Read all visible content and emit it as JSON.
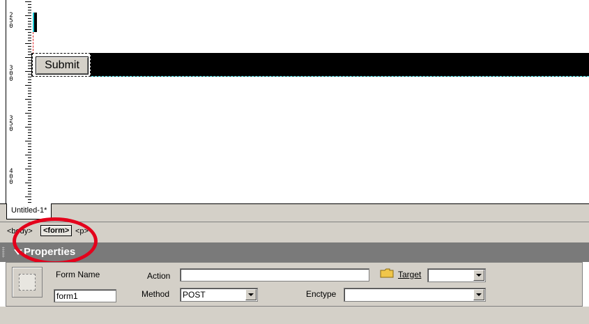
{
  "ruler": {
    "labels": [
      "250",
      "300",
      "350",
      "400"
    ]
  },
  "canvas": {
    "submit_label": "Submit"
  },
  "document_tab": {
    "label": "Untitled-1*"
  },
  "tag_selector": {
    "body": "<body>",
    "form": "<form>",
    "p": "<p>"
  },
  "properties": {
    "title": "Properties",
    "form_name_label": "Form Name",
    "form_name_value": "form1",
    "action_label": "Action",
    "action_value": "",
    "target_label": "Target",
    "target_value": "",
    "method_label": "Method",
    "method_value": "POST",
    "enctype_label": "Enctype",
    "enctype_value": ""
  },
  "colors": {
    "highlight_circle": "#e4001b",
    "panel_bg": "#d4d0c8",
    "header_bg": "#7a7a7a"
  }
}
